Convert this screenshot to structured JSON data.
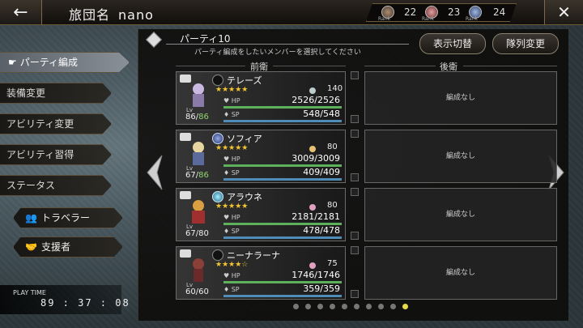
{
  "header": {
    "title": "旅団名",
    "name": "nano",
    "back_icon": "←",
    "close_icon": "✕",
    "ranks": [
      {
        "icon": "skull-rank-icon",
        "value": "22",
        "label": "Rank"
      },
      {
        "icon": "flower-rank-icon",
        "value": "23",
        "label": "Rank"
      },
      {
        "icon": "gear-rank-icon",
        "value": "24",
        "label": "Rank"
      }
    ]
  },
  "menu": {
    "items": [
      {
        "label": "パーティ編成",
        "active": true
      },
      {
        "label": "装備変更"
      },
      {
        "label": "アビリティ変更"
      },
      {
        "label": "アビリティ習得"
      },
      {
        "label": "ステータス"
      }
    ],
    "traveler_label": "トラベラー",
    "supporter_label": "支援者",
    "playtime_label": "PLAY TIME",
    "playtime_value": "89 : 37 : 08"
  },
  "party": {
    "title": "パーティ10",
    "subtitle": "パーティ編成をしたいメンバーを選択してください",
    "display_toggle_label": "表示切替",
    "formation_change_label": "隊列変更",
    "front_label": "前衛",
    "back_label": "後衛",
    "empty_label": "編成なし",
    "members": [
      {
        "name": "テレーズ",
        "stars": "★★★★★",
        "level_icon": "moon-icon",
        "ring": "none",
        "level_num": "140",
        "lv": "86",
        "lv_max": "86",
        "lv_max_green": true,
        "hp": "2526/2526",
        "sp": "548/548",
        "portrait_color": "#c9b8e0"
      },
      {
        "name": "ソフィア",
        "stars": "★★★★★",
        "level_icon": "sun-icon",
        "ring": "blue",
        "level_num": "80",
        "lv": "67",
        "lv_max": "86",
        "lv_max_green": true,
        "hp": "3009/3009",
        "sp": "409/409",
        "portrait_color": "#e8d6a0"
      },
      {
        "name": "アラウネ",
        "stars": "★★★★★",
        "level_icon": "flower-icon",
        "ring": "cyan",
        "level_num": "80",
        "lv": "67",
        "lv_max": "80",
        "lv_max_green": false,
        "hp": "2181/2181",
        "sp": "478/478",
        "portrait_color": "#d8a040"
      },
      {
        "name": "ニーナラーナ",
        "stars": "★★★★☆",
        "level_icon": "flower-icon",
        "ring": "none",
        "level_num": "75",
        "lv": "60",
        "lv_max": "60",
        "lv_max_green": false,
        "hp": "1746/1746",
        "sp": "359/359",
        "portrait_color": "#8a4038"
      }
    ],
    "hp_label": "HP",
    "sp_label": "SP",
    "lv_label": "Lv",
    "page_count": 10,
    "active_page": 9
  }
}
